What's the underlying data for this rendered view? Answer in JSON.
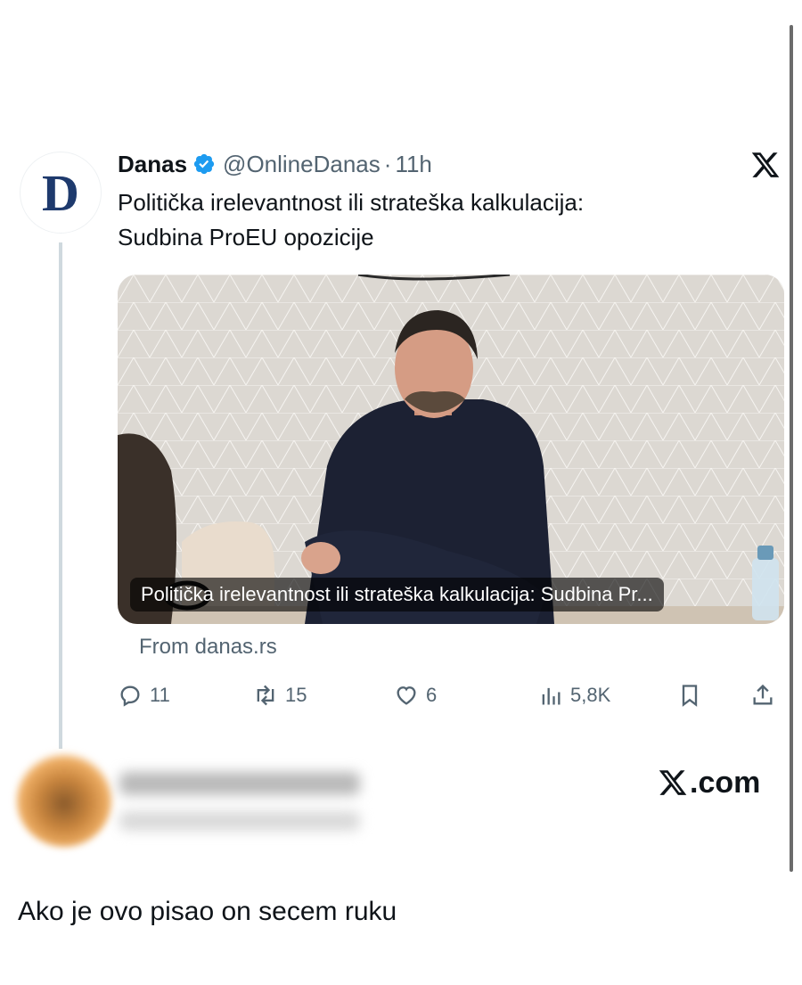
{
  "tweet": {
    "avatar_letter": "D",
    "author": "Danas",
    "handle": "@OnlineDanas",
    "separator": "·",
    "time": "11h",
    "text_line1": "Politička irelevantnost ili strateška kalkulacija:",
    "text_line2": "Sudbina ProEU opozicije",
    "card": {
      "caption": "Politička irelevantnost ili strateška kalkulacija: Sudbina Pr...",
      "source": "From danas.rs"
    },
    "stats": {
      "replies": "11",
      "retweets": "15",
      "likes": "6",
      "views": "5,8K"
    }
  },
  "footer": {
    "brand": ".com"
  },
  "comment": {
    "text": "Ako je ovo pisao on secem ruku"
  },
  "colors": {
    "verified": "#1d9bf0",
    "muted": "#536471",
    "text": "#0f1419",
    "logo_blue": "#1e3a6d"
  },
  "icons": [
    "verified-badge-icon",
    "x-logo-icon",
    "reply-icon",
    "retweet-icon",
    "like-icon",
    "views-icon",
    "bookmark-icon",
    "share-icon"
  ]
}
